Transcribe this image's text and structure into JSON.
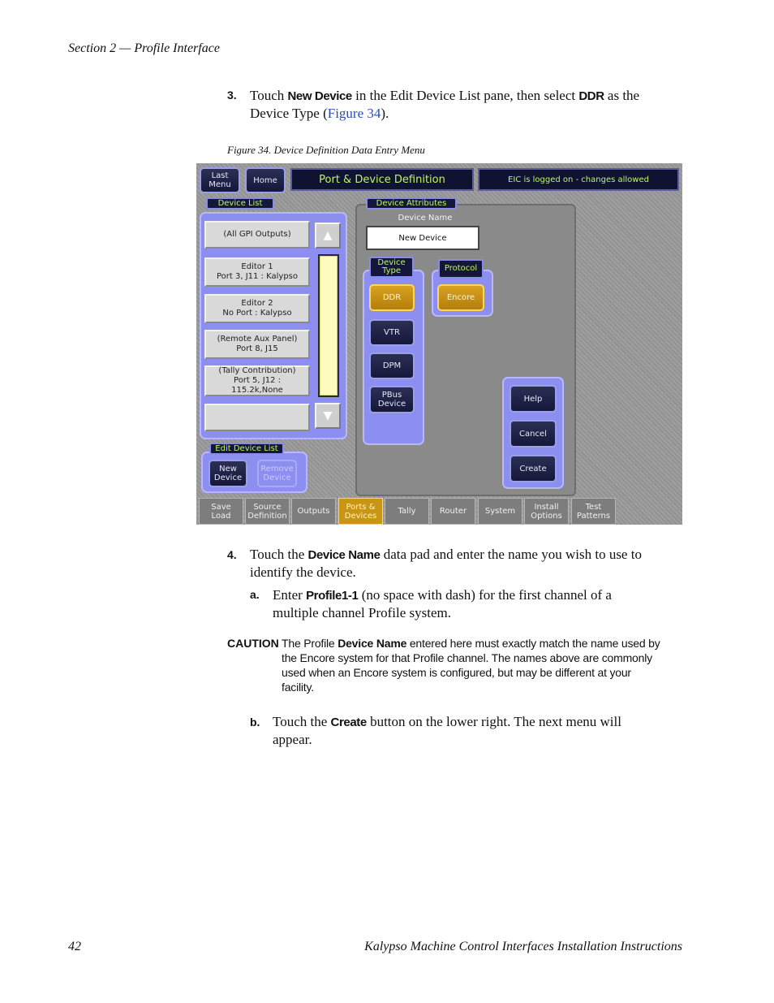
{
  "header": {
    "section": "Section 2 — Profile Interface"
  },
  "step3": {
    "num": "3.",
    "t1": "Touch ",
    "k1": "New Device",
    "t2": " in the Edit Device List pane, then select ",
    "k2": "DDR",
    "t3": " as the",
    "t4": "Device Type (",
    "link": "Figure 34",
    "t5": ")."
  },
  "figure": {
    "caption": "Figure 34.  Device Definition Data Entry Menu",
    "top_bar": {
      "last_menu": "Last Menu",
      "home": "Home",
      "title": "Port & Device Definition",
      "status": "EIC is logged on - changes allowed"
    },
    "device_list": {
      "label": "Device List",
      "items": [
        {
          "l1": "(All GPI Outputs)",
          "l2": "",
          "l3": ""
        },
        {
          "l1": "Editor 1",
          "l2": "Port 3, J11 : Kalypso",
          "l3": ""
        },
        {
          "l1": "Editor 2",
          "l2": "No Port  : Kalypso",
          "l3": ""
        },
        {
          "l1": "(Remote Aux Panel)",
          "l2": "Port 8, J15",
          "l3": ""
        },
        {
          "l1": "(Tally Contribution)",
          "l2": "Port 5, J12 :",
          "l3": "115.2k,None"
        },
        {
          "l1": "",
          "l2": "",
          "l3": ""
        }
      ]
    },
    "edit_device_list": {
      "label": "Edit Device List",
      "new_device": "New Device",
      "remove_device": "Remove Device"
    },
    "device_attributes": {
      "label": "Device Attributes",
      "name_label": "Device Name",
      "name_value": "New Device",
      "device_type_label": "Device Type",
      "device_types": [
        "DDR",
        "VTR",
        "DPM",
        "PBus Device"
      ],
      "protocol_label": "Protocol",
      "protocol_value": "Encore"
    },
    "actions": {
      "help": "Help",
      "cancel": "Cancel",
      "create": "Create"
    },
    "tabs": [
      {
        "l1": "Save",
        "l2": "Load"
      },
      {
        "l1": "Source",
        "l2": "Definition"
      },
      {
        "l1": "Outputs",
        "l2": ""
      },
      {
        "l1": "Ports &",
        "l2": "Devices"
      },
      {
        "l1": "Tally",
        "l2": ""
      },
      {
        "l1": "Router",
        "l2": ""
      },
      {
        "l1": "System",
        "l2": ""
      },
      {
        "l1": "Install",
        "l2": "Options"
      },
      {
        "l1": "Test",
        "l2": "Patterns"
      }
    ]
  },
  "step4": {
    "num": "4.",
    "t1": "Touch the ",
    "k1": "Device Name",
    "t2": " data pad and enter the name you wish to use to",
    "t3": "identify the device."
  },
  "step4a": {
    "num": "a.",
    "t1": "Enter ",
    "k1": "Profile1-1",
    "t2": " (no space with dash) for the first channel of a",
    "t3": "multiple channel Profile system."
  },
  "caution": {
    "label": "CAUTION",
    "t1": "The Profile ",
    "k1": "Device Name",
    "t2": " entered here must exactly match the name used by",
    "l2": "the Encore system for that Profile channel. The names above are commonly",
    "l3": "used when an Encore system is configured, but may be different at your",
    "l4": "facility."
  },
  "step4b": {
    "num": "b.",
    "t1": "Touch the ",
    "k1": "Create",
    "t2": " button on the lower right. The next menu will",
    "t3": "appear."
  },
  "footer": {
    "page": "42",
    "title": "Kalypso Machine Control Interfaces Installation Instructions"
  }
}
